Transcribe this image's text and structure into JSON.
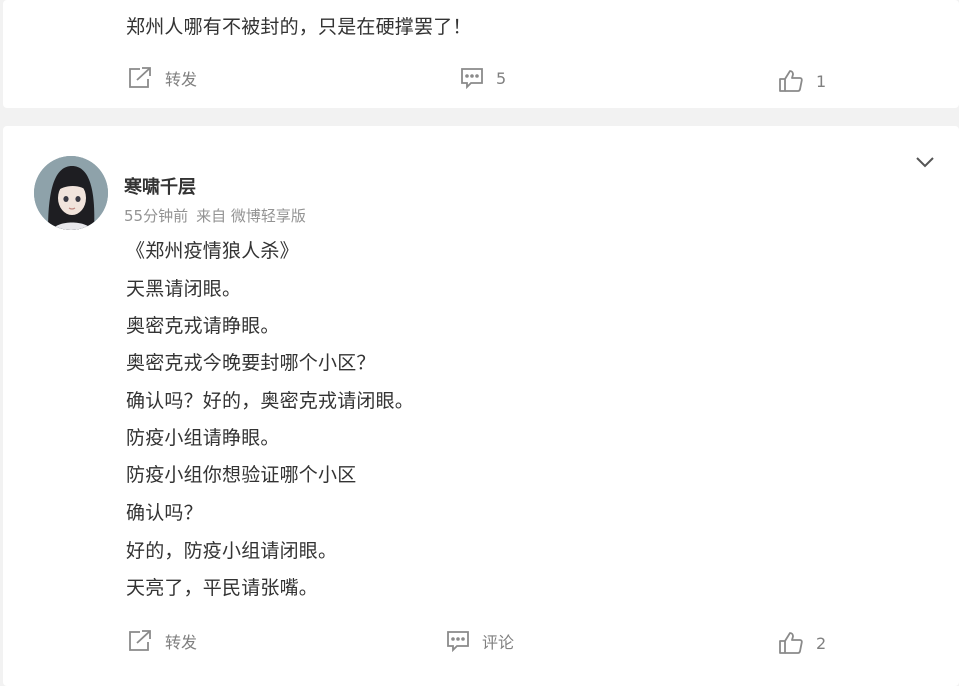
{
  "post1": {
    "text": "郑州人哪有不被封的，只是在硬撑罢了！",
    "actions": {
      "repost_label": "转发",
      "comment_count": "5",
      "like_count": "1"
    }
  },
  "post2": {
    "username": "寒啸千层",
    "time": "55分钟前",
    "source": "来自 微博轻享版",
    "lines": [
      "《郑州疫情狼人杀》",
      "天黑请闭眼。",
      "奥密克戎请睁眼。",
      "奥密克戎今晚要封哪个小区？",
      "确认吗？好的，奥密克戎请闭眼。",
      "防疫小组请睁眼。",
      "防疫小组你想验证哪个小区",
      "确认吗？",
      "好的，防疫小组请闭眼。",
      "天亮了，平民请张嘴。"
    ],
    "actions": {
      "repost_label": "转发",
      "comment_label": "评论",
      "like_count": "2"
    }
  },
  "icons": {
    "repost": "share-icon",
    "comment": "comment-icon",
    "like": "thumbs-up-icon",
    "more": "chevron-down-icon"
  },
  "colors": {
    "background": "#f2f2f2",
    "card": "#ffffff",
    "text": "#333333",
    "muted": "#808080"
  }
}
